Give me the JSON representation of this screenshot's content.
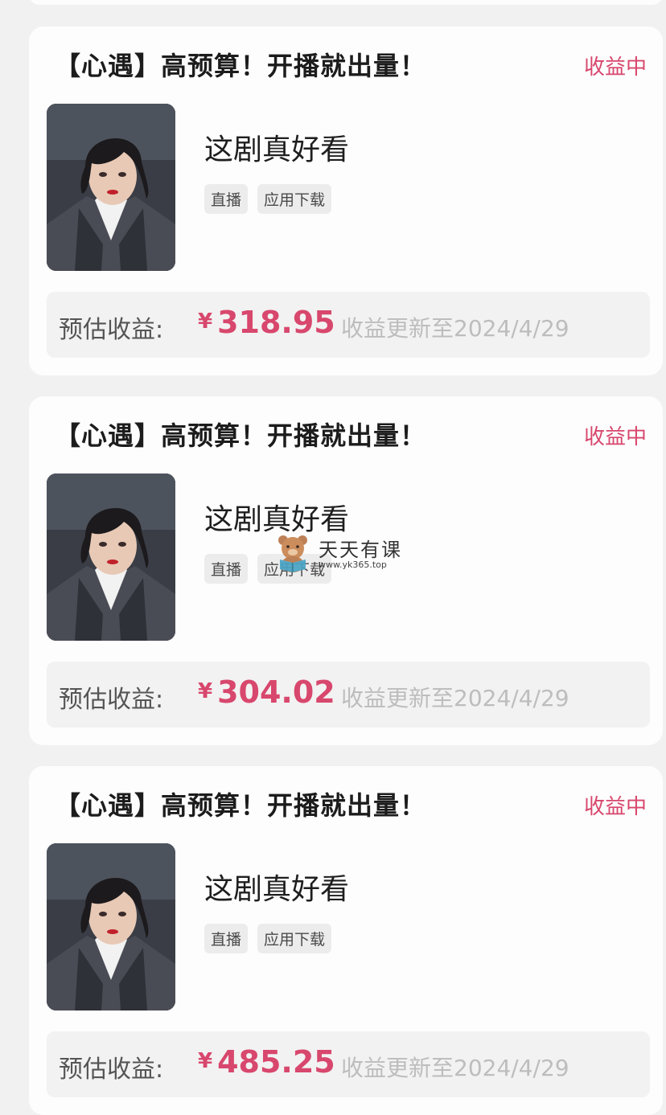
{
  "cards": [
    {
      "title": "【心遇】高预算！开播就出量！",
      "status": "收益中",
      "drama_name": "这剧真好看",
      "tags": [
        "直播",
        "应用下载"
      ],
      "earn_label": "预估收益:",
      "currency": "¥",
      "amount": "318.95",
      "update_text": "收益更新至2024/4/29"
    },
    {
      "title": "【心遇】高预算！开播就出量！",
      "status": "收益中",
      "drama_name": "这剧真好看",
      "tags": [
        "直播",
        "应用下载"
      ],
      "earn_label": "预估收益:",
      "currency": "¥",
      "amount": "304.02",
      "update_text": "收益更新至2024/4/29"
    },
    {
      "title": "【心遇】高预算！开播就出量！",
      "status": "收益中",
      "drama_name": "这剧真好看",
      "tags": [
        "直播",
        "应用下载"
      ],
      "earn_label": "预估收益:",
      "currency": "¥",
      "amount": "485.25",
      "update_text": "收益更新至2024/4/29"
    }
  ],
  "watermark": {
    "name": "天天有课",
    "url": "www.yk365.top"
  },
  "colors": {
    "accent": "#d8476d",
    "page_bg": "#f1f1f1",
    "card_bg": "#fdfdfd",
    "earn_bg": "#f2f2f2"
  },
  "icons": {
    "watermark_logo": "bear-reading-icon"
  }
}
